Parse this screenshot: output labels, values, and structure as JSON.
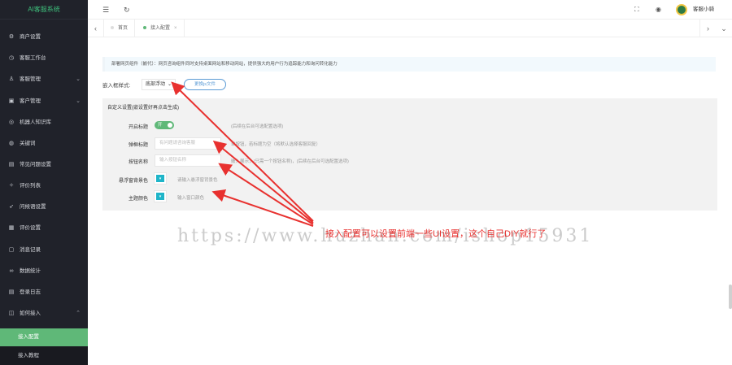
{
  "sidebar": {
    "logo": "AI客服系统",
    "items": [
      {
        "label": "商户设置",
        "icon": "gear-icon",
        "glyph": "⚙"
      },
      {
        "label": "客服工作台",
        "icon": "clock-icon",
        "glyph": "◷"
      },
      {
        "label": "客服管理",
        "icon": "user-icon",
        "glyph": "♙",
        "chevron": "⌄"
      },
      {
        "label": "客户管理",
        "icon": "customer-icon",
        "glyph": "▣",
        "chevron": "⌄"
      },
      {
        "label": "机器人知识库",
        "icon": "robot-icon",
        "glyph": "◎"
      },
      {
        "label": "关键词",
        "icon": "keyword-icon",
        "glyph": "◍"
      },
      {
        "label": "常见问题设置",
        "icon": "faq-icon",
        "glyph": "▤"
      },
      {
        "label": "评价列表",
        "icon": "rating-icon",
        "glyph": "✧"
      },
      {
        "label": "问候语设置",
        "icon": "send-icon",
        "glyph": "➶"
      },
      {
        "label": "评价设置",
        "icon": "settings-icon",
        "glyph": "▦"
      },
      {
        "label": "消息记录",
        "icon": "message-icon",
        "glyph": "▢"
      },
      {
        "label": "数据统计",
        "icon": "stats-icon",
        "glyph": "∞"
      },
      {
        "label": "登录日志",
        "icon": "log-icon",
        "glyph": "▤"
      },
      {
        "label": "如何接入",
        "icon": "access-icon",
        "glyph": "◫",
        "chevron": "⌃"
      }
    ],
    "sub_items": [
      "接入配置",
      "接入教程"
    ]
  },
  "topbar": {
    "menu_icon": "☰",
    "refresh_icon": "↻",
    "fullscreen_icon": "⛶",
    "theme_icon": "◉",
    "username": "客服小骑"
  },
  "tabs": {
    "prev": "‹",
    "next": "›",
    "more": "⌄",
    "items": [
      {
        "label": "首页",
        "close": ""
      },
      {
        "label": "接入配置",
        "close": "×"
      }
    ]
  },
  "content": {
    "notice": "部署网页组件（嵌代）：网页咨询组件同时支持桌面网站和移动网站，提供强大的用户行为追踪能力和询问转化能力",
    "style_label": "嵌入框样式:",
    "style_value": "底部浮动",
    "upload_button": "更换js文件",
    "panel_title": "自定义设置(嵌设置好再点击生成)",
    "rows": [
      {
        "label": "开启标题",
        "type": "switch",
        "value": "开",
        "hint": "(后续在后台可选配置选项)"
      },
      {
        "label": "弹框标题",
        "type": "input",
        "placeholder": "有问题请咨询客服",
        "hint": "单按钮，若标题为空（将默认选择客服回复）"
      },
      {
        "label": "按钮名称",
        "type": "input",
        "placeholder": "输入按钮名称",
        "hint": "嵌入展示，(只需一个按钮名称)，(后续在后台可选配置选项)"
      },
      {
        "label": "悬浮窗背景色",
        "type": "color",
        "value": "▾",
        "hint": "请输入悬浮窗背景色"
      },
      {
        "label": "主题颜色",
        "type": "color",
        "value": "▾",
        "hint": "输入窗口颜色"
      }
    ]
  },
  "annotation": {
    "text": "接入配置可以设置前端一些UI设置，这个自己DIY就行了",
    "watermark": "https://www.huzhan.com/ishop15931",
    "color": "#e8312f"
  },
  "colors": {
    "sidebar_bg": "#20222a",
    "accent_green": "#5fb878",
    "theme_teal": "#1fb5c9",
    "logo_text": "#3ec07c"
  }
}
